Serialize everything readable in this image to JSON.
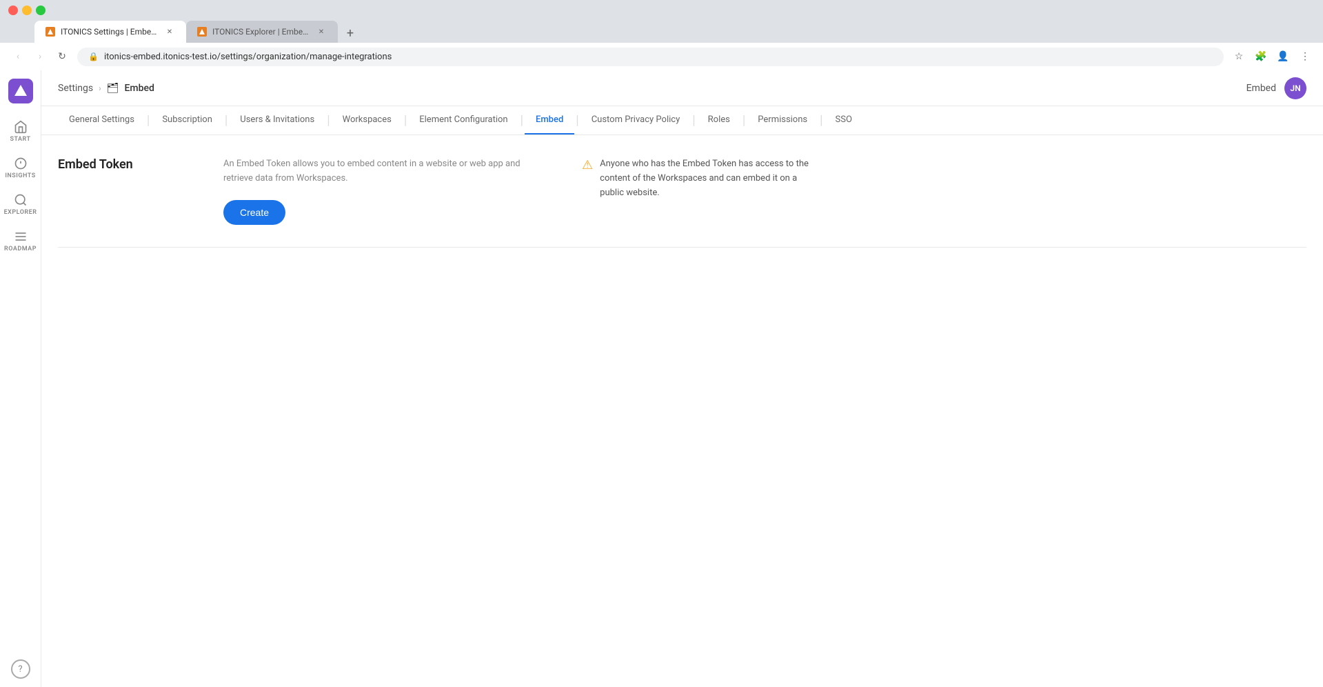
{
  "browser": {
    "tabs": [
      {
        "id": "tab1",
        "title": "ITONICS Settings | Embed – Em…",
        "url": "itonics-embed.itonics-test.io/settings/organization/manage-integrations",
        "active": true,
        "favicon_color": "#e67e22"
      },
      {
        "id": "tab2",
        "title": "ITONICS Explorer | Embed – Tr…",
        "url": "",
        "active": false,
        "favicon_color": "#e67e22"
      }
    ],
    "url": "itonics-embed.itonics-test.io/settings/organization/manage-integrations"
  },
  "header": {
    "breadcrumb_settings": "Settings",
    "breadcrumb_arrow": "›",
    "breadcrumb_icon": "🗂",
    "breadcrumb_current": "Embed",
    "embed_label": "Embed",
    "user_initials": "JN"
  },
  "sidebar": {
    "logo_alt": "A",
    "items": [
      {
        "id": "start",
        "label": "START",
        "icon": "home"
      },
      {
        "id": "insights",
        "label": "INSIGHTS",
        "icon": "insights"
      },
      {
        "id": "explorer",
        "label": "EXPLORER",
        "icon": "explorer"
      },
      {
        "id": "roadmap",
        "label": "ROADMAP",
        "icon": "roadmap"
      }
    ],
    "help_label": "?"
  },
  "tabs": [
    {
      "id": "general",
      "label": "General Settings",
      "active": false
    },
    {
      "id": "subscription",
      "label": "Subscription",
      "active": false
    },
    {
      "id": "users",
      "label": "Users & Invitations",
      "active": false
    },
    {
      "id": "workspaces",
      "label": "Workspaces",
      "active": false
    },
    {
      "id": "element",
      "label": "Element Configuration",
      "active": false
    },
    {
      "id": "embed",
      "label": "Embed",
      "active": true
    },
    {
      "id": "privacy",
      "label": "Custom Privacy Policy",
      "active": false
    },
    {
      "id": "roles",
      "label": "Roles",
      "active": false
    },
    {
      "id": "permissions",
      "label": "Permissions",
      "active": false
    },
    {
      "id": "sso",
      "label": "SSO",
      "active": false
    }
  ],
  "embed_token": {
    "title": "Embed Token",
    "description": "An Embed Token allows you to embed content in a website or web app and retrieve data from Workspaces.",
    "create_button": "Create",
    "warning": "Anyone who has the Embed Token has access to the content of the Workspaces and can embed it on a public website."
  }
}
